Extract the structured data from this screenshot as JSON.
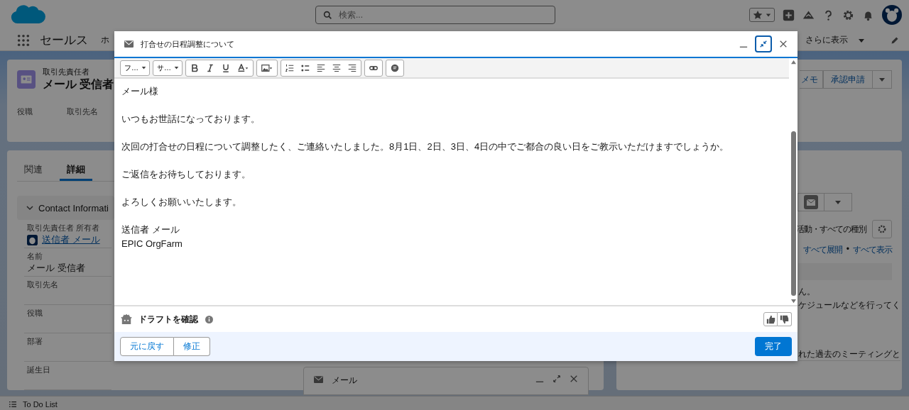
{
  "header": {
    "search": {
      "placeholder": "検索..."
    }
  },
  "nav": {
    "app_name": "セールス",
    "item": "ホ",
    "more": "さらに表示"
  },
  "record": {
    "type": "取引先責任者",
    "name": "メール 受信者",
    "fields": [
      "役職",
      "取引先名"
    ],
    "actions": [
      "メモ",
      "承認申請"
    ]
  },
  "detail_tabs": [
    {
      "label": "関連",
      "selected": false
    },
    {
      "label": "詳細",
      "selected": true
    }
  ],
  "section": {
    "title": "Contact Informati",
    "expanded": true
  },
  "fields": [
    {
      "label": "取引先責任者 所有者",
      "value": "送信者 メール",
      "kind": "user"
    },
    {
      "label": "名前",
      "value": "メール 受信者",
      "kind": "text"
    },
    {
      "label": "取引先名",
      "kind": "text"
    },
    {
      "label": "役職",
      "kind": "text"
    },
    {
      "label": "部署",
      "kind": "text"
    },
    {
      "label": "誕生日",
      "kind": "text"
    }
  ],
  "activity": {
    "filter": "活動・すべての種別",
    "links": [
      "すべて展開",
      "すべて表示"
    ],
    "separator": "•",
    "messages": [
      "ん。",
      "ケジュールなどを行ってく",
      "れた過去のミーティングと"
    ]
  },
  "docked_mail": {
    "title": "メール"
  },
  "utility_bar": {
    "label": "To Do List"
  },
  "composer": {
    "subject": "打合せの日程調整について",
    "font": "フ…",
    "size": "サ…",
    "body": [
      [
        "メール様"
      ],
      [
        "いつもお世話になっております。"
      ],
      [
        "次回の打合せの日程について調整したく、ご連絡いたしました。8月1日、2日、3日、4日の中でご都合の良い日をご教示いただけますでしょうか。"
      ],
      [
        "ご返信をお待ちしております。"
      ],
      [
        "よろしくお願いいたします。"
      ],
      [
        "送信者 メール",
        "EPIC OrgFarm"
      ]
    ],
    "draft_label": "ドラフトを確認",
    "buttons": [
      "元に戻す",
      "修正"
    ],
    "done": "完了"
  }
}
